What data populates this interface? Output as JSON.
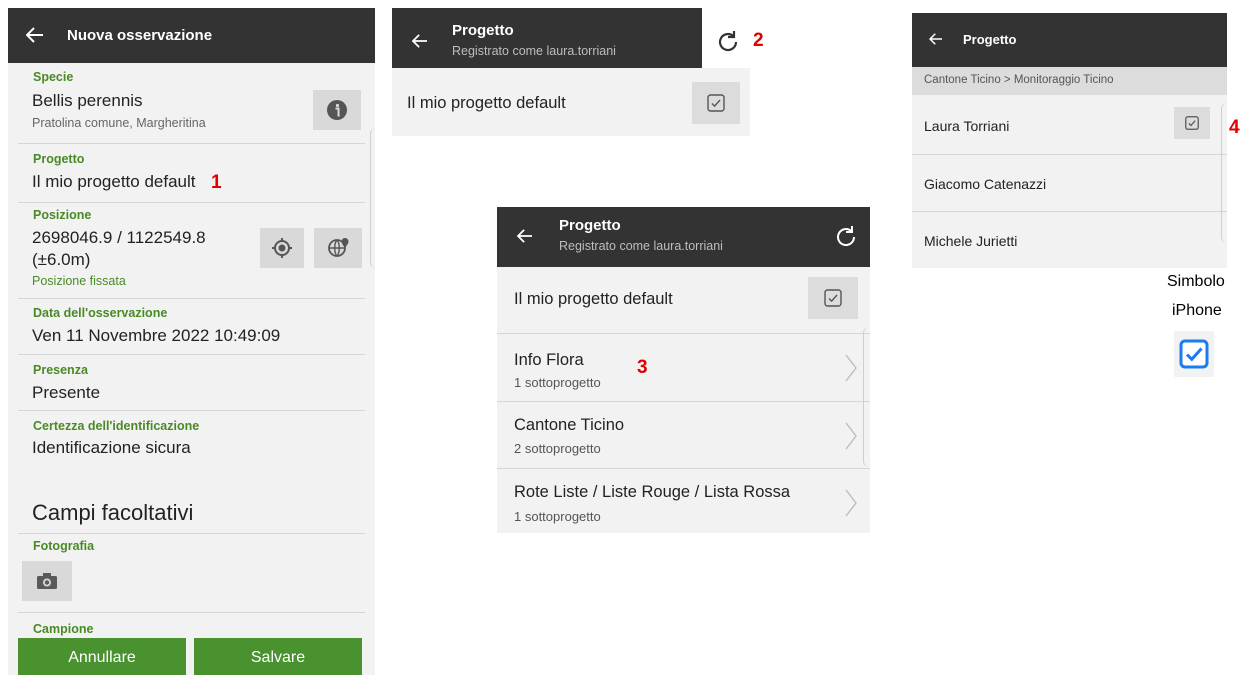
{
  "observation": {
    "title": "Nuova osservazione",
    "species_label": "Specie",
    "species_name": "Bellis perennis",
    "species_common": "Pratolina comune, Margheritina",
    "project_label": "Progetto",
    "project_value": "Il mio progetto default",
    "marker": "1",
    "position_label": "Posizione",
    "position_coords": "2698046.9 / 1122549.8",
    "position_accuracy": "(±6.0m)",
    "position_status": "Posizione fissata",
    "date_label": "Data dell'osservazione",
    "date_value": "Ven 11 Novembre 2022 10:49:09",
    "presence_label": "Presenza",
    "presence_value": "Presente",
    "certainty_label": "Certezza dell'identificazione",
    "certainty_value": "Identificazione sicura",
    "optional_heading": "Campi facoltativi",
    "photo_label": "Fotografia",
    "cut_label": "Campione",
    "cancel_button": "Annullare",
    "save_button": "Salvare"
  },
  "project_small": {
    "title": "Progetto",
    "subtitle": "Registrato come laura.torriani",
    "item": "Il mio progetto default",
    "marker": "2"
  },
  "project_list": {
    "title": "Progetto",
    "subtitle": "Registrato come laura.torriani",
    "default_item": "Il mio progetto default",
    "marker": "3",
    "items": [
      {
        "title": "Info Flora",
        "sub": "1 sottoprogetto"
      },
      {
        "title": "Cantone Ticino",
        "sub": "2 sottoprogetto"
      },
      {
        "title": "Rote Liste / Liste Rouge / Lista Rossa",
        "sub": "1 sottoprogetto"
      }
    ]
  },
  "project_people": {
    "title": "Progetto",
    "breadcrumb": "Cantone Ticino > Monitoraggio Ticino",
    "marker": "4",
    "people": [
      "Laura Torriani",
      "Giacomo Catenazzi",
      "Michele Jurietti"
    ]
  },
  "iphone_note": {
    "line1": "Simbolo",
    "line2": "iPhone"
  },
  "colors": {
    "appbar": "#333333",
    "accent_green": "#4a8a26",
    "button_green": "#4a9130",
    "marker_red": "#e00000",
    "iphone_blue": "#1a7cf0"
  },
  "icons": [
    "back-arrow-icon",
    "info-icon",
    "target-icon",
    "globe-icon",
    "camera-icon",
    "refresh-icon",
    "checkbox-icon",
    "chevron-right-icon"
  ]
}
